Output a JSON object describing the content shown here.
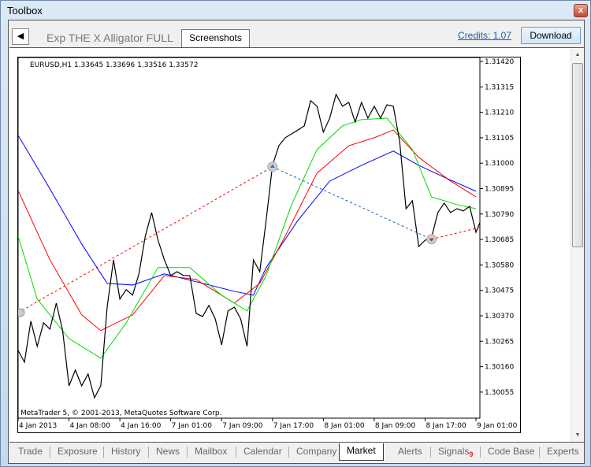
{
  "window": {
    "title": "Toolbox",
    "close_icon": "close-icon"
  },
  "header": {
    "back_icon": "triangle-left-icon",
    "product_name": "Exp THE X Alligator FULL",
    "active_tab": "Screenshots",
    "credits": "Credits: 1.07",
    "download": "Download"
  },
  "bottom_tabs": [
    {
      "label": "Trade"
    },
    {
      "label": "Exposure"
    },
    {
      "label": "History"
    },
    {
      "label": "News"
    },
    {
      "label": "Mailbox"
    },
    {
      "label": "Calendar"
    },
    {
      "label": "Company"
    },
    {
      "label": "Market",
      "active": true
    },
    {
      "label": "Alerts"
    },
    {
      "label": "Signals",
      "badge": "9"
    },
    {
      "label": "Code Base"
    },
    {
      "label": "Experts"
    }
  ],
  "colors": {
    "jaw": "#0000ff",
    "teeth": "#ff0000",
    "lips": "#00dd00",
    "price": "#000000",
    "badge": "#e02020",
    "link": "#1e5aa8"
  },
  "chart_data": {
    "type": "line",
    "header": "EURUSD,H1  1.33645 1.33696 1.33516 1.33572",
    "copyright": "MetaTrader 5, © 2001-2013, MetaQuotes Software Corp.",
    "y_ticks": [
      "1.31420",
      "1.31315",
      "1.31210",
      "1.31105",
      "1.31000",
      "1.30895",
      "1.30790",
      "1.30685",
      "1.30580",
      "1.30475",
      "1.30370",
      "1.30265",
      "1.30160",
      "1.30055"
    ],
    "ylim": [
      1.2995,
      1.3145
    ],
    "x_ticks": [
      "4 Jan 2013",
      "4 Jan 08:00",
      "4 Jan 16:00",
      "7 Jan 01:00",
      "7 Jan 09:00",
      "7 Jan 17:00",
      "8 Jan 01:00",
      "8 Jan 09:00",
      "8 Jan 17:00",
      "9 Jan 01:00"
    ],
    "grid": false,
    "close": [
      1.30227,
      1.30179,
      1.30348,
      1.30244,
      1.30341,
      1.30315,
      1.30422,
      1.30309,
      1.30081,
      1.30146,
      1.30081,
      1.3013,
      1.30032,
      1.30081,
      1.30406,
      1.30601,
      1.30439,
      1.30478,
      1.30455,
      1.30543,
      1.30699,
      1.30796,
      1.30682,
      1.30601,
      1.30536,
      1.30552,
      1.30536,
      1.30536,
      1.3038,
      1.30367,
      1.30413,
      1.30357,
      1.3025,
      1.3039,
      1.30406,
      1.30357,
      1.30244,
      1.30601,
      1.30552,
      1.30764,
      1.30991,
      1.31072,
      1.31105,
      1.31121,
      1.31137,
      1.31154,
      1.31258,
      1.31235,
      1.31128,
      1.31186,
      1.31284,
      1.31235,
      1.31251,
      1.3117,
      1.31251,
      1.31186,
      1.31235,
      1.31186,
      1.31241,
      1.31235,
      1.31089,
      1.30812,
      1.30845,
      1.30656,
      1.30682,
      1.30692,
      1.30796,
      1.30835,
      1.30796,
      1.30812,
      1.30803,
      1.30822,
      1.30715,
      1.3078
    ],
    "series": [
      {
        "color": "#0000ff",
        "points": [
          [
            0,
            1.31115
          ],
          [
            5,
            1.30894
          ],
          [
            10,
            1.30666
          ],
          [
            14,
            1.30504
          ],
          [
            18,
            1.30497
          ],
          [
            23,
            1.30543
          ],
          [
            29,
            1.30504
          ],
          [
            34,
            1.30471
          ],
          [
            37,
            1.30455
          ],
          [
            39,
            1.30569
          ],
          [
            44,
            1.30764
          ],
          [
            49,
            1.30926
          ],
          [
            54,
            1.30991
          ],
          [
            59,
            1.3105
          ],
          [
            63,
            1.30991
          ],
          [
            67,
            1.30942
          ],
          [
            72,
            1.30884
          ]
        ]
      },
      {
        "color": "#ff0000",
        "points": [
          [
            0,
            1.30887
          ],
          [
            5,
            1.30601
          ],
          [
            10,
            1.30374
          ],
          [
            13,
            1.30309
          ],
          [
            18,
            1.30374
          ],
          [
            23,
            1.30536
          ],
          [
            28,
            1.3052
          ],
          [
            34,
            1.30422
          ],
          [
            38,
            1.30504
          ],
          [
            42,
            1.30699
          ],
          [
            47,
            1.30959
          ],
          [
            52,
            1.31072
          ],
          [
            56,
            1.31105
          ],
          [
            59,
            1.31137
          ],
          [
            63,
            1.31024
          ],
          [
            68,
            1.30926
          ],
          [
            72,
            1.30861
          ]
        ]
      },
      {
        "color": "#00dd00",
        "points": [
          [
            0,
            1.30699
          ],
          [
            3,
            1.30439
          ],
          [
            8,
            1.30276
          ],
          [
            13,
            1.30195
          ],
          [
            17,
            1.30341
          ],
          [
            22,
            1.30569
          ],
          [
            27,
            1.30569
          ],
          [
            32,
            1.30455
          ],
          [
            36,
            1.3039
          ],
          [
            39,
            1.30536
          ],
          [
            43,
            1.30829
          ],
          [
            47,
            1.31056
          ],
          [
            51,
            1.31154
          ],
          [
            54,
            1.3118
          ],
          [
            58,
            1.31186
          ],
          [
            62,
            1.31056
          ],
          [
            65,
            1.30861
          ],
          [
            69,
            1.30829
          ],
          [
            72,
            1.30812
          ]
        ]
      }
    ],
    "trades": [
      {
        "type": "entry-line",
        "color": "#ff0000",
        "from": [
          0,
          1.30383
        ],
        "to": [
          40,
          1.30985
        ]
      },
      {
        "type": "buy",
        "color": "#1e6ad0",
        "at": [
          40,
          1.30985
        ]
      },
      {
        "type": "exit-line",
        "color": "#1e5ac0",
        "from": [
          40,
          1.30985
        ],
        "to": [
          65,
          1.30686
        ]
      },
      {
        "type": "sell",
        "color": "#e02020",
        "at": [
          65,
          1.30686
        ]
      },
      {
        "type": "entry-line",
        "color": "#ff0000",
        "from": [
          65,
          1.30686
        ],
        "to": [
          73,
          1.30737
        ]
      }
    ]
  }
}
